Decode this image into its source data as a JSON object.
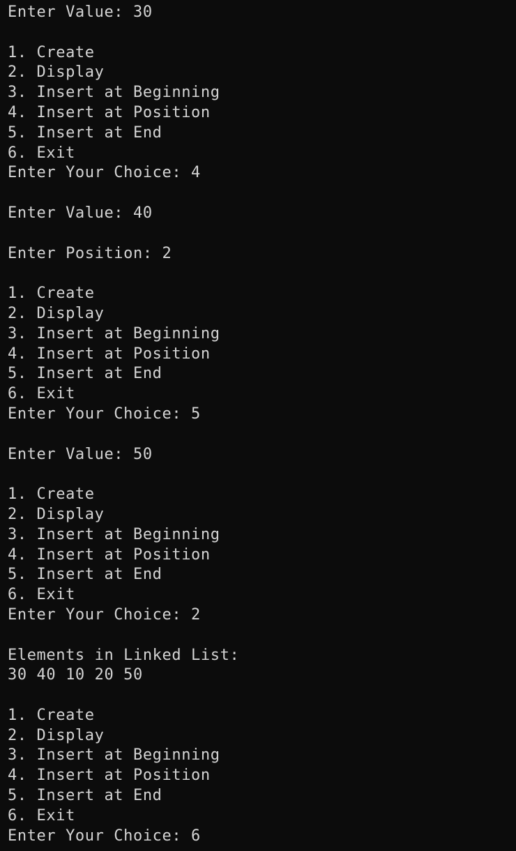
{
  "terminal": {
    "lines": [
      "Enter Value: 30",
      "",
      "1. Create",
      "2. Display",
      "3. Insert at Beginning",
      "4. Insert at Position",
      "5. Insert at End",
      "6. Exit",
      "Enter Your Choice: 4",
      "",
      "Enter Value: 40",
      "",
      "Enter Position: 2",
      "",
      "1. Create",
      "2. Display",
      "3. Insert at Beginning",
      "4. Insert at Position",
      "5. Insert at End",
      "6. Exit",
      "Enter Your Choice: 5",
      "",
      "Enter Value: 50",
      "",
      "1. Create",
      "2. Display",
      "3. Insert at Beginning",
      "4. Insert at Position",
      "5. Insert at End",
      "6. Exit",
      "Enter Your Choice: 2",
      "",
      "Elements in Linked List:",
      "30 40 10 20 50",
      "",
      "1. Create",
      "2. Display",
      "3. Insert at Beginning",
      "4. Insert at Position",
      "5. Insert at End",
      "6. Exit",
      "Enter Your Choice: 6"
    ]
  },
  "colors": {
    "background": "#0c0c0c",
    "foreground": "#d4d4d4"
  }
}
